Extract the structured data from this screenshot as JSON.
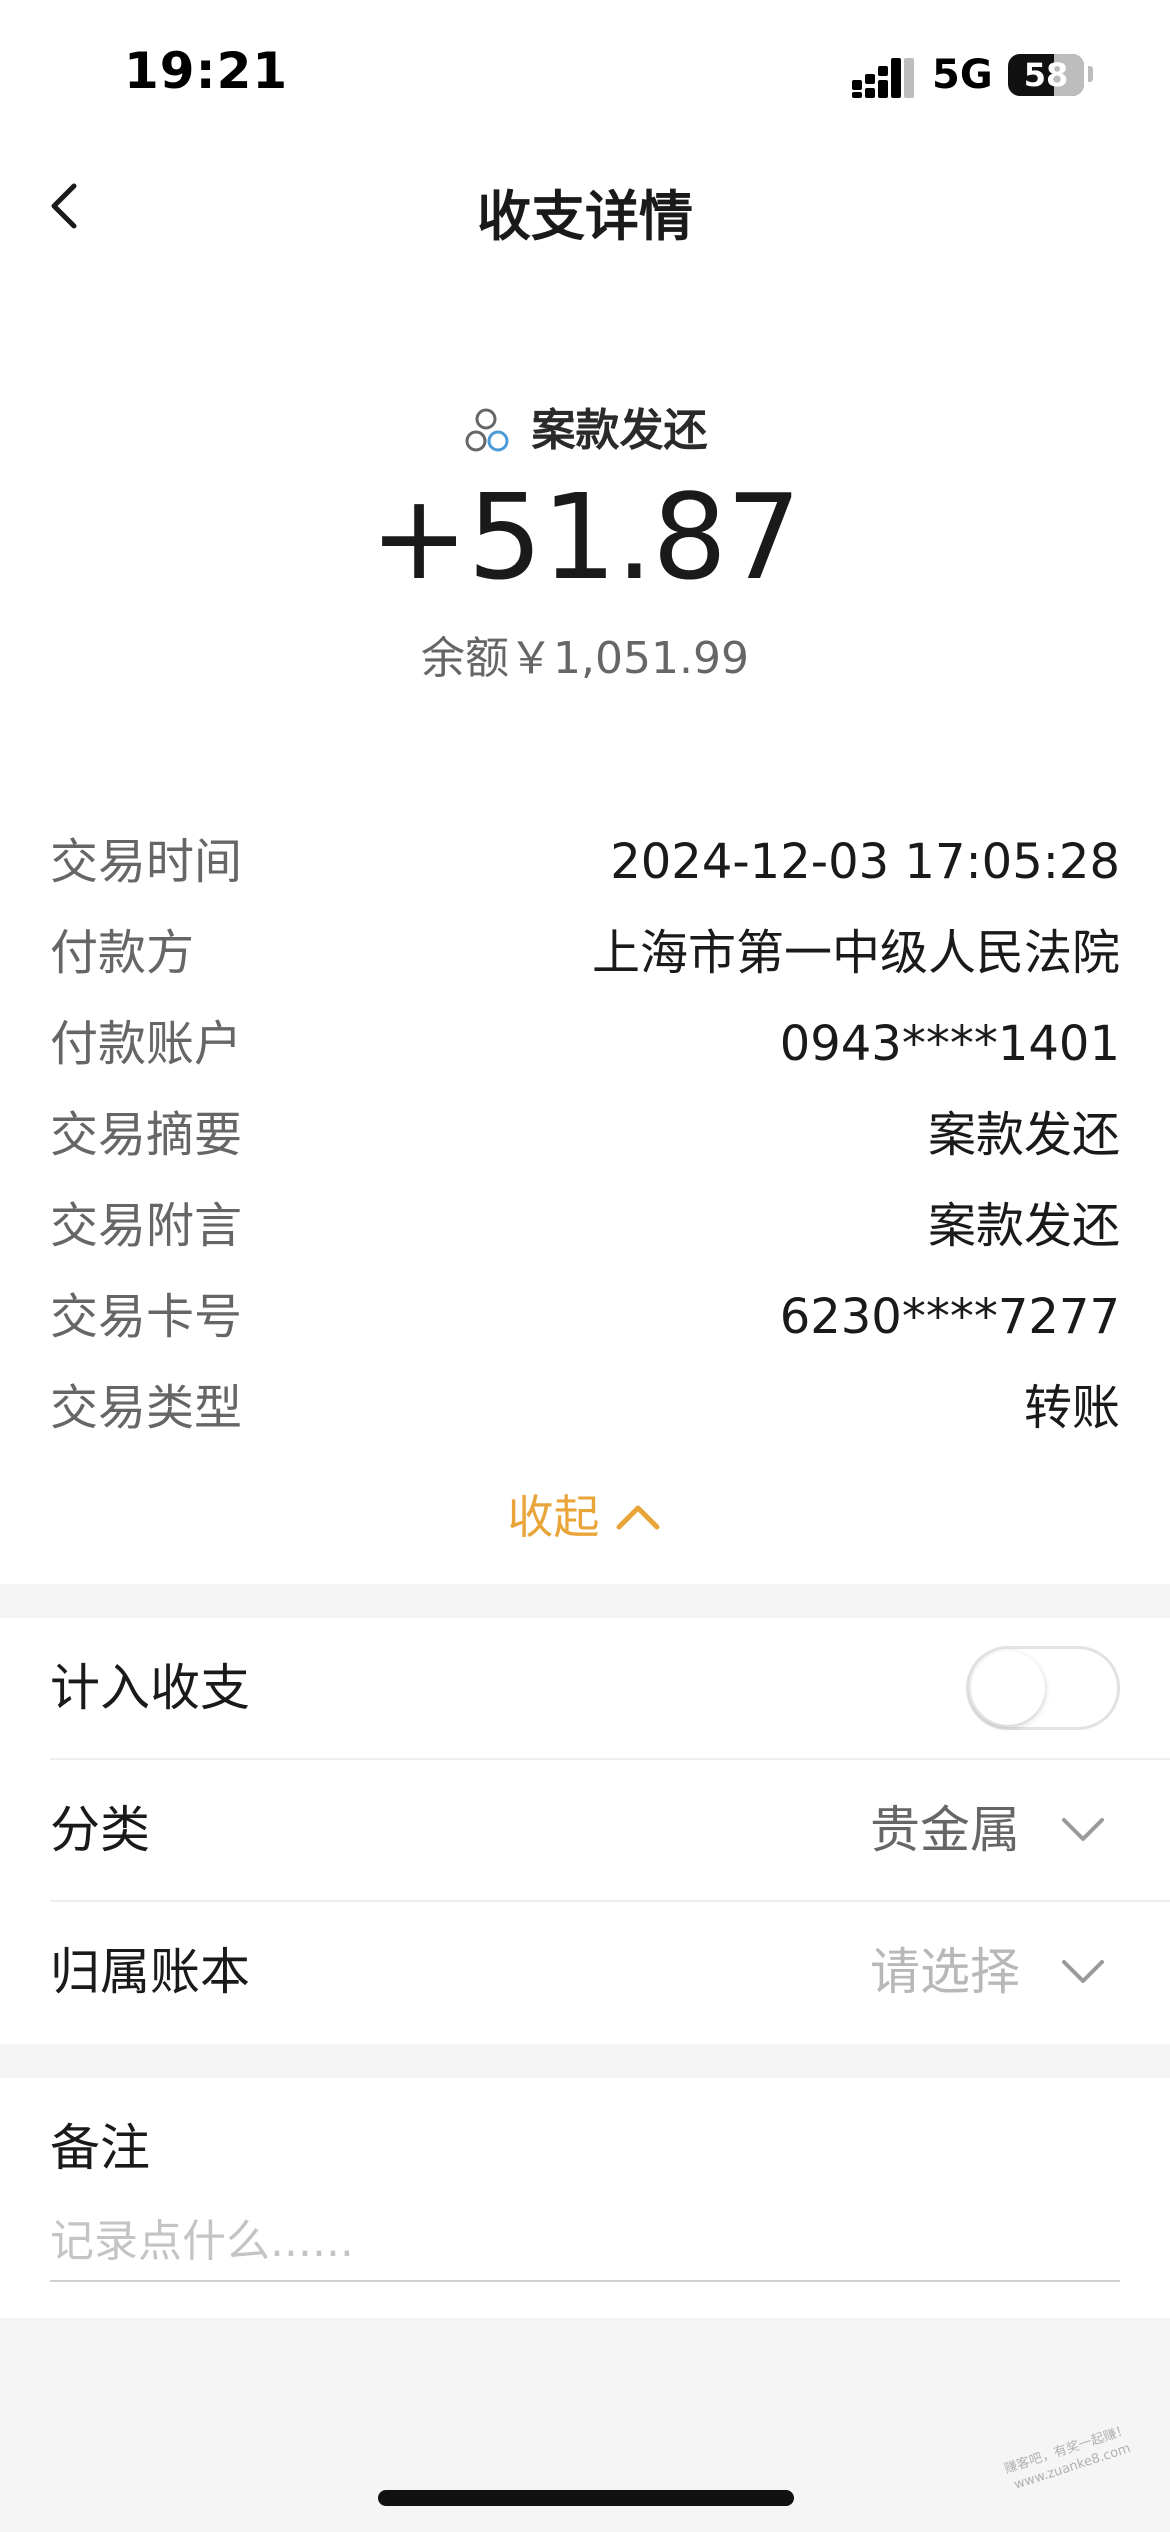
{
  "status_bar": {
    "time": "19:21",
    "network": "5G",
    "battery": "58"
  },
  "nav": {
    "title": "收支详情"
  },
  "summary": {
    "category": "案款发还",
    "amount": "+51.87",
    "balance": "余额￥1,051.99"
  },
  "details": [
    {
      "label": "交易时间",
      "value": "2024-12-03 17:05:28"
    },
    {
      "label": "付款方",
      "value": "上海市第一中级人民法院"
    },
    {
      "label": "付款账户",
      "value": "0943****1401"
    },
    {
      "label": "交易摘要",
      "value": "案款发还"
    },
    {
      "label": "交易附言",
      "value": "案款发还"
    },
    {
      "label": "交易卡号",
      "value": "6230****7277"
    },
    {
      "label": "交易类型",
      "value": "转账"
    }
  ],
  "collapse_label": "收起",
  "settings": {
    "include_label": "计入收支",
    "include_enabled": false,
    "category_label": "分类",
    "category_value": "贵金属",
    "ledger_label": "归属账本",
    "ledger_placeholder": "请选择"
  },
  "note": {
    "title": "备注",
    "placeholder": "记录点什么......"
  },
  "watermark": {
    "line1": "赚客吧，有奖一起赚！",
    "line2": "www.zuanke8.com"
  },
  "colors": {
    "accent": "#e9a53a",
    "icon_blue": "#4a9bd8"
  },
  "icons": {
    "back": "chevron-left-icon",
    "category": "category-circles-icon",
    "collapse": "chevron-up-icon",
    "dropdown": "chevron-down-icon"
  }
}
